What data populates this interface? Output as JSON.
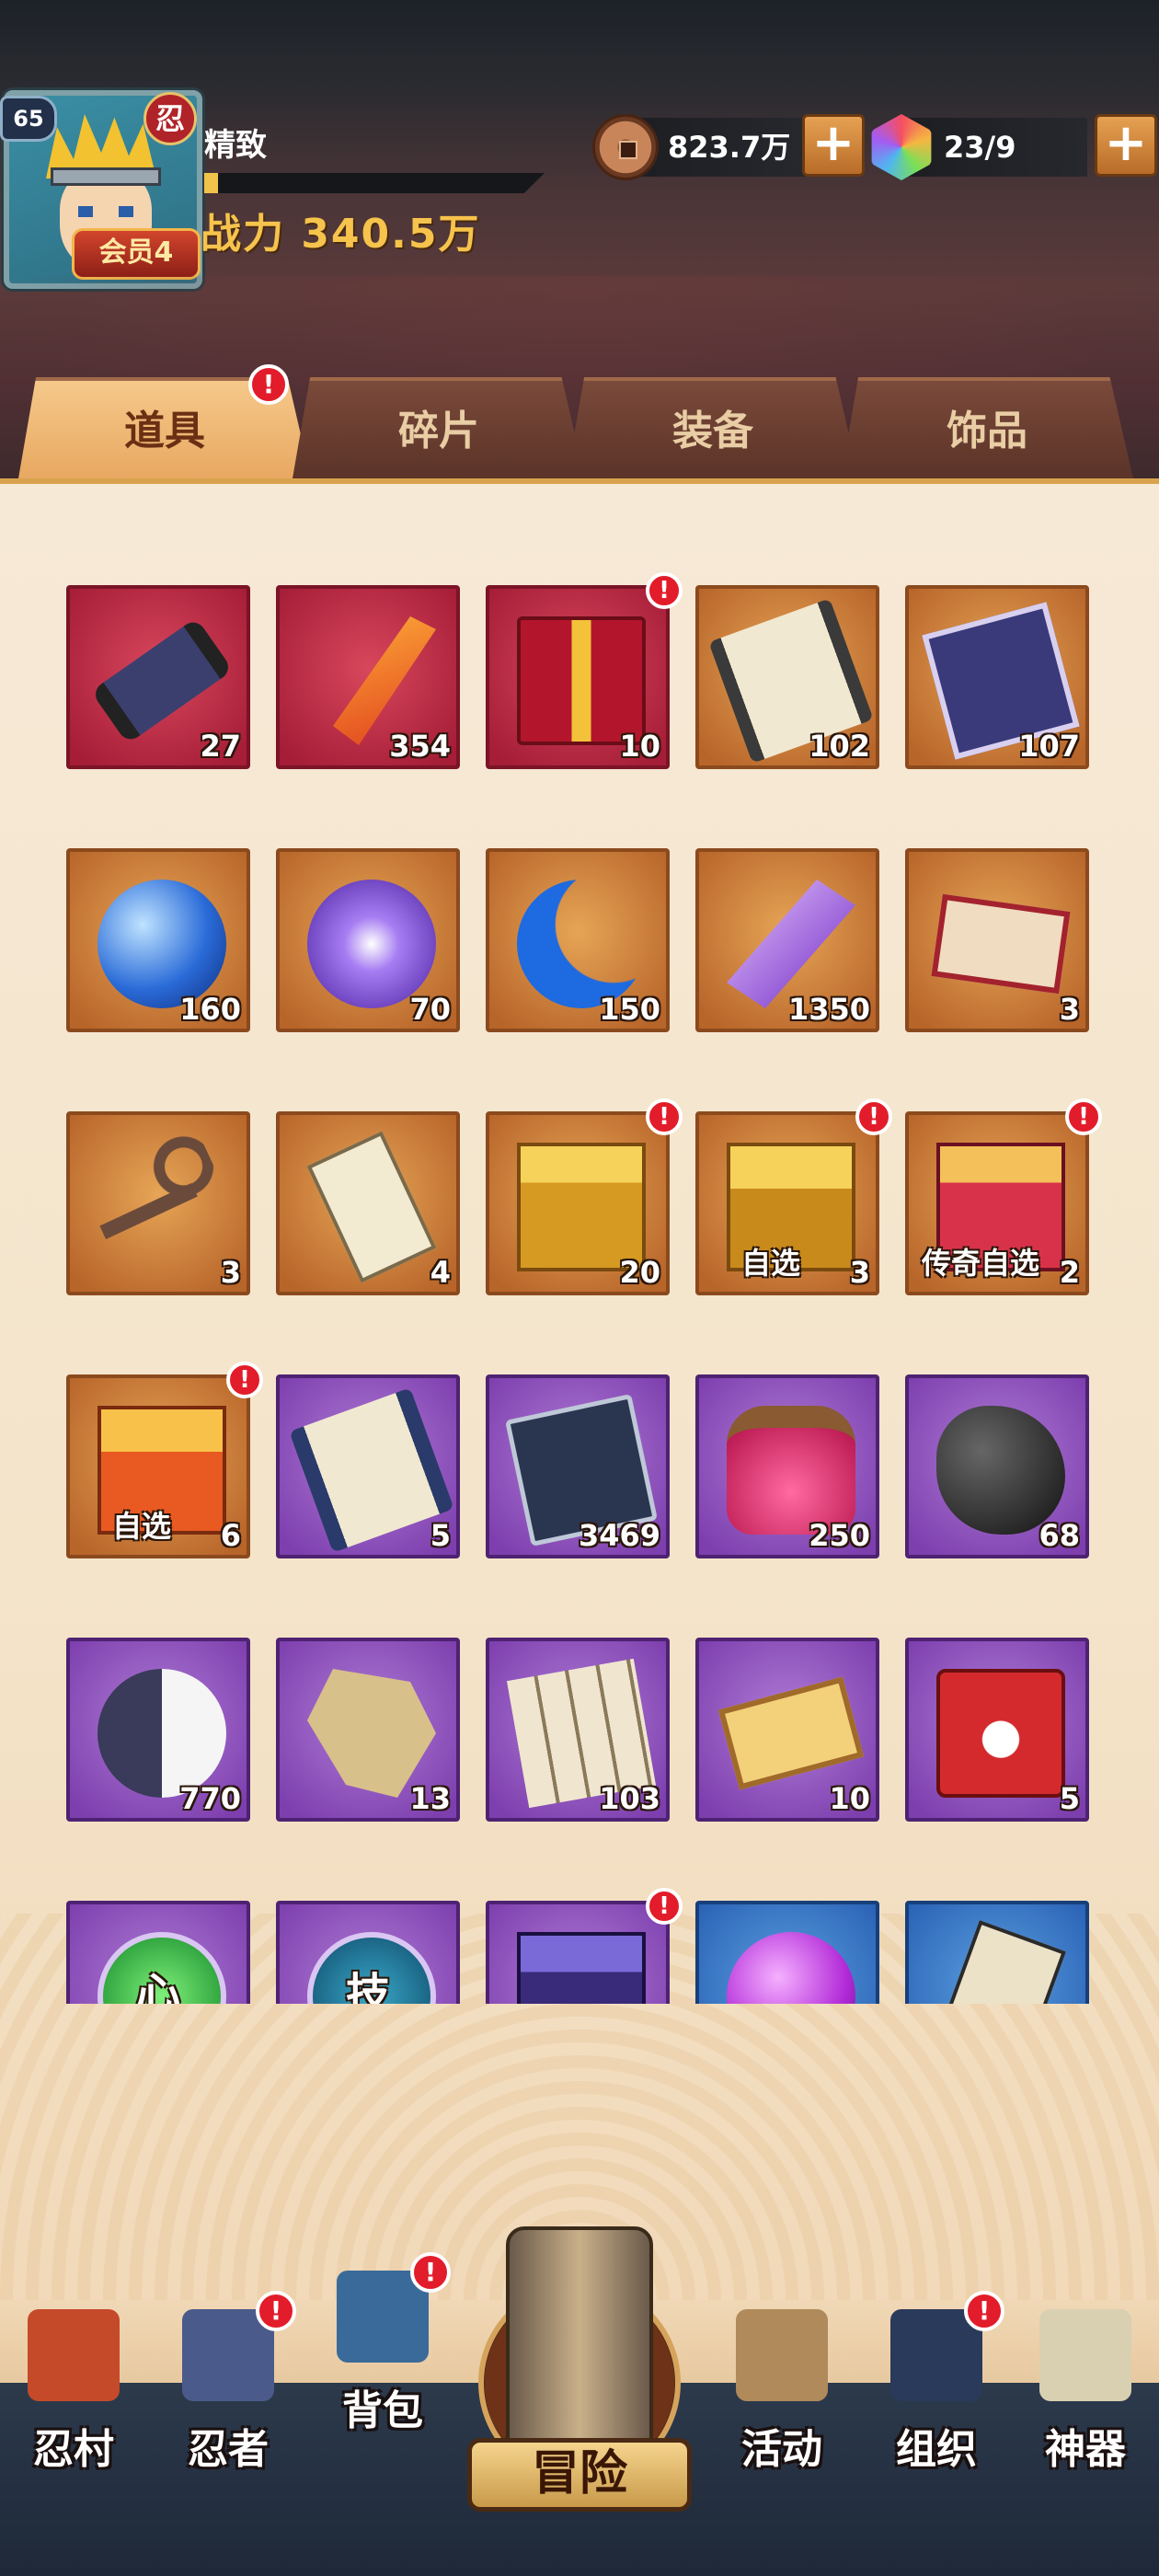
{
  "header": {
    "level": "65",
    "ninja_mark": "忍",
    "vip_label": "会员4",
    "player_name": "精致",
    "exp_fraction": 0.04,
    "power_text": "战力 340.5万",
    "coins_value": "823.7万",
    "gems_value": "23/9",
    "plus_label": "+"
  },
  "tabs": [
    {
      "label": "道具",
      "active": true,
      "alert": "!"
    },
    {
      "label": "碎片",
      "active": false
    },
    {
      "label": "装备",
      "active": false
    },
    {
      "label": "饰品",
      "active": false
    }
  ],
  "items": [
    {
      "icon": "scroll-tied-icon",
      "rarity": "red",
      "count": "27",
      "label": "",
      "alert": false
    },
    {
      "icon": "feather-icon",
      "rarity": "red",
      "count": "354",
      "label": "",
      "alert": false
    },
    {
      "icon": "gift-box-icon",
      "rarity": "red",
      "count": "10",
      "label": "",
      "alert": true
    },
    {
      "icon": "open-scroll-icon",
      "rarity": "orange",
      "count": "102",
      "label": "",
      "alert": false
    },
    {
      "icon": "exchange-ticket-icon",
      "rarity": "orange",
      "count": "107",
      "label": "",
      "alert": false
    },
    {
      "icon": "blue-orb-icon",
      "rarity": "orange",
      "count": "160",
      "label": "",
      "alert": false
    },
    {
      "icon": "purple-orb-icon",
      "rarity": "orange",
      "count": "70",
      "label": "",
      "alert": false
    },
    {
      "icon": "moon-crystal-icon",
      "rarity": "orange",
      "count": "150",
      "label": "",
      "alert": false
    },
    {
      "icon": "purple-crystal-icon",
      "rarity": "orange",
      "count": "1350",
      "label": "",
      "alert": false
    },
    {
      "icon": "fortune-banner-icon",
      "rarity": "orange",
      "count": "3",
      "label": "",
      "alert": false
    },
    {
      "icon": "key-icon",
      "rarity": "orange",
      "count": "3",
      "label": "",
      "alert": false
    },
    {
      "icon": "paper-charm-icon",
      "rarity": "orange",
      "count": "4",
      "label": "",
      "alert": false
    },
    {
      "icon": "gold-chest-icon",
      "rarity": "orange",
      "count": "20",
      "label": "",
      "alert": true
    },
    {
      "icon": "gold-chest-open-icon",
      "rarity": "orange",
      "count": "3",
      "label": "自选",
      "alert": true
    },
    {
      "icon": "red-chest-icon",
      "rarity": "orange",
      "count": "2",
      "label": "传奇自选",
      "alert": true
    },
    {
      "icon": "orange-chest-icon",
      "rarity": "orange",
      "count": "6",
      "label": "自选",
      "alert": true
    },
    {
      "icon": "blue-scroll-icon",
      "rarity": "purple",
      "count": "5",
      "label": "",
      "alert": false
    },
    {
      "icon": "book-icon",
      "rarity": "purple",
      "count": "3469",
      "label": "",
      "alert": false
    },
    {
      "icon": "jar-icon",
      "rarity": "purple",
      "count": "250",
      "label": "",
      "alert": false
    },
    {
      "icon": "ore-icon",
      "rarity": "purple",
      "count": "68",
      "label": "",
      "alert": false
    },
    {
      "icon": "yin-yang-icon",
      "rarity": "purple",
      "count": "770",
      "label": "",
      "alert": false
    },
    {
      "icon": "map-piece-icon",
      "rarity": "purple",
      "count": "13",
      "label": "",
      "alert": false
    },
    {
      "icon": "cards-icon",
      "rarity": "purple",
      "count": "103",
      "label": "",
      "alert": false
    },
    {
      "icon": "fortune-ticket-icon",
      "rarity": "purple",
      "count": "10",
      "label": "",
      "alert": false
    },
    {
      "icon": "medkit-icon",
      "rarity": "purple",
      "count": "5",
      "label": "",
      "alert": false
    },
    {
      "icon": "heart-orb-icon",
      "rarity": "purple",
      "count": "",
      "label": "心",
      "alert": false
    },
    {
      "icon": "skill-orb-icon",
      "rarity": "purple",
      "count": "",
      "label": "技",
      "alert": false
    },
    {
      "icon": "purple-box-icon",
      "rarity": "purple",
      "count": "",
      "label": "",
      "alert": true
    },
    {
      "icon": "violet-orb-icon",
      "rarity": "blue",
      "count": "",
      "label": "",
      "alert": false
    },
    {
      "icon": "war-scroll-icon",
      "rarity": "blue",
      "count": "",
      "label": "",
      "alert": false
    }
  ],
  "nav": [
    {
      "label": "忍村",
      "icon": "village-gate-icon",
      "alert": false
    },
    {
      "label": "忍者",
      "icon": "ninja-face-icon",
      "alert": true
    },
    {
      "label": "背包",
      "icon": "backpack-icon",
      "alert": true
    },
    {
      "label": "冒险",
      "icon": "adventure-scroll-icon",
      "alert": false
    },
    {
      "label": "活动",
      "icon": "drum-icon",
      "alert": false
    },
    {
      "label": "组织",
      "icon": "team-icon",
      "alert": true
    },
    {
      "label": "神器",
      "icon": "artifact-scroll-icon",
      "alert": false
    }
  ],
  "alert_mark": "!",
  "colors": {
    "red_tile": "#a51d37",
    "orange_tile": "#b8652a",
    "purple_tile": "#7d3fae",
    "blue_tile": "#2a62b5",
    "alert": "#e21c2a",
    "gold": "#f6c34c"
  }
}
